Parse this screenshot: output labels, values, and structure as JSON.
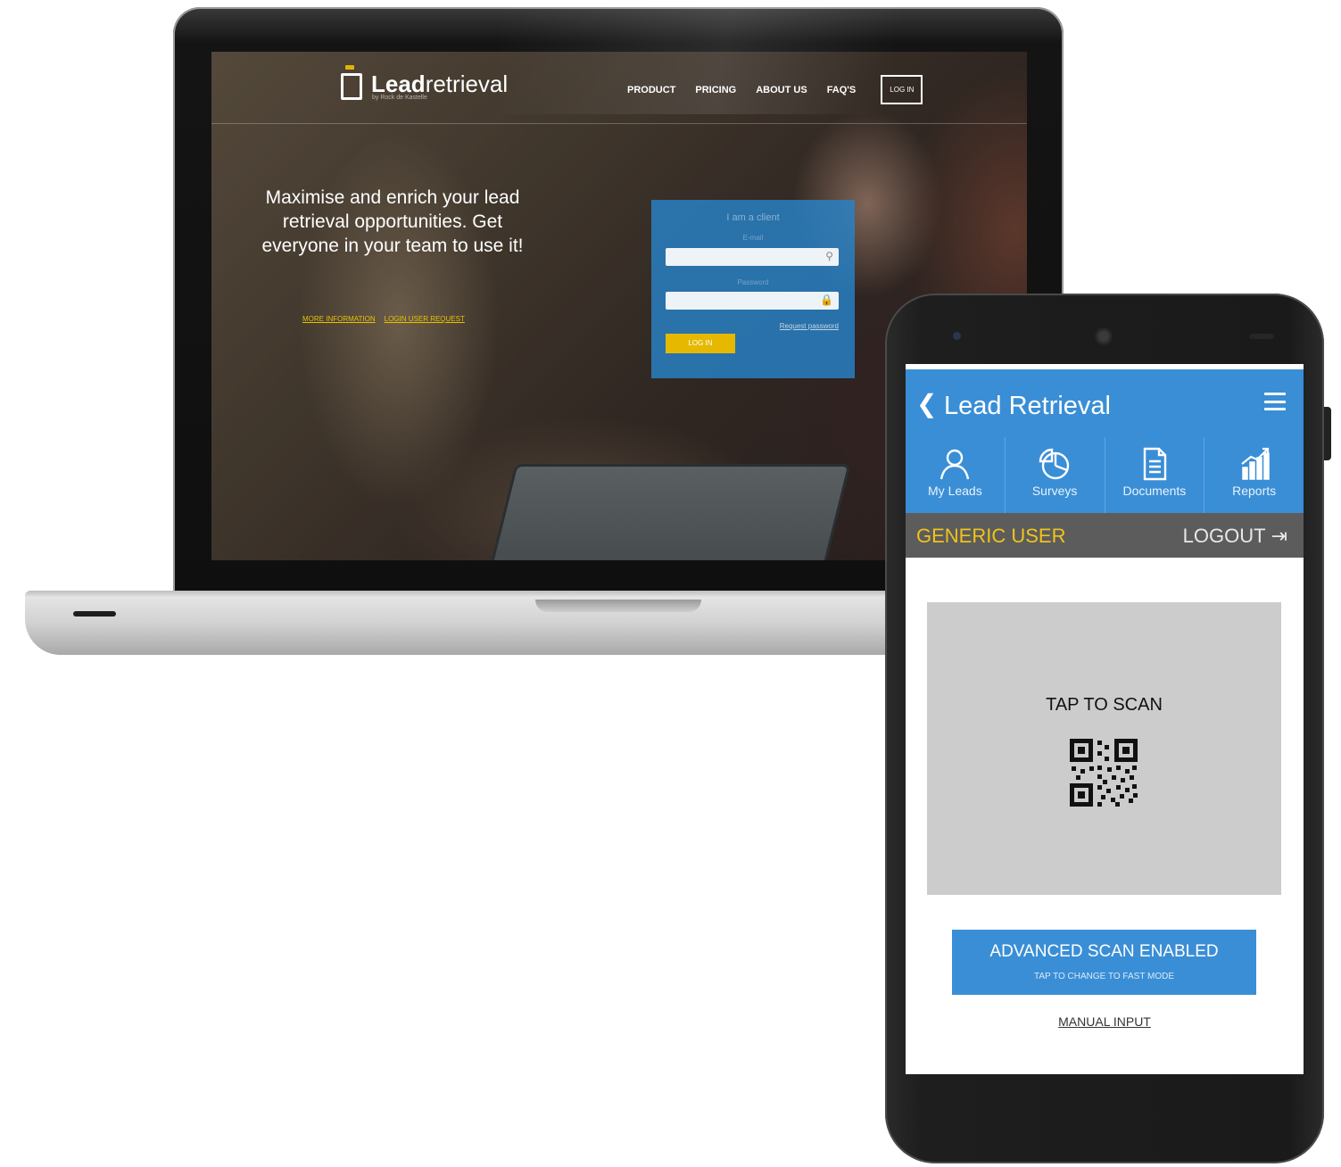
{
  "website": {
    "logo_bold": "Lead",
    "logo_light": "retrieval",
    "logo_tagline": "by Rock de Kastelle",
    "nav": [
      "PRODUCT",
      "PRICING",
      "ABOUT US",
      "FAQ'S"
    ],
    "login_button": "LOG IN",
    "headline": "Maximise and enrich your lead retrieval opportunities. Get everyone in your team to use it!",
    "links": [
      "MORE INFORMATION",
      "LOGIN USER REQUEST"
    ],
    "login_card": {
      "title": "I am a client",
      "email_label": "E-mail",
      "password_label": "Password",
      "forgot": "Request password",
      "button": "LOG IN"
    }
  },
  "app": {
    "title": "Lead Retrieval",
    "tabs": [
      {
        "label": "My Leads",
        "icon": "person-icon"
      },
      {
        "label": "Surveys",
        "icon": "pie-chart-icon"
      },
      {
        "label": "Documents",
        "icon": "document-icon"
      },
      {
        "label": "Reports",
        "icon": "bar-chart-icon"
      }
    ],
    "user_name": "GENERIC USER",
    "logout_label": "LOGOUT",
    "scan_label": "TAP TO SCAN",
    "advanced_scan": {
      "title": "ADVANCED SCAN ENABLED",
      "subtitle": "TAP TO CHANGE TO FAST MODE"
    },
    "manual_input": "MANUAL INPUT"
  },
  "colors": {
    "app_blue": "#3a8ed6",
    "user_bar": "#5c5c5c",
    "user_name": "#f0c419",
    "scan_bg": "#cccccc",
    "site_accent": "#e6b800"
  }
}
